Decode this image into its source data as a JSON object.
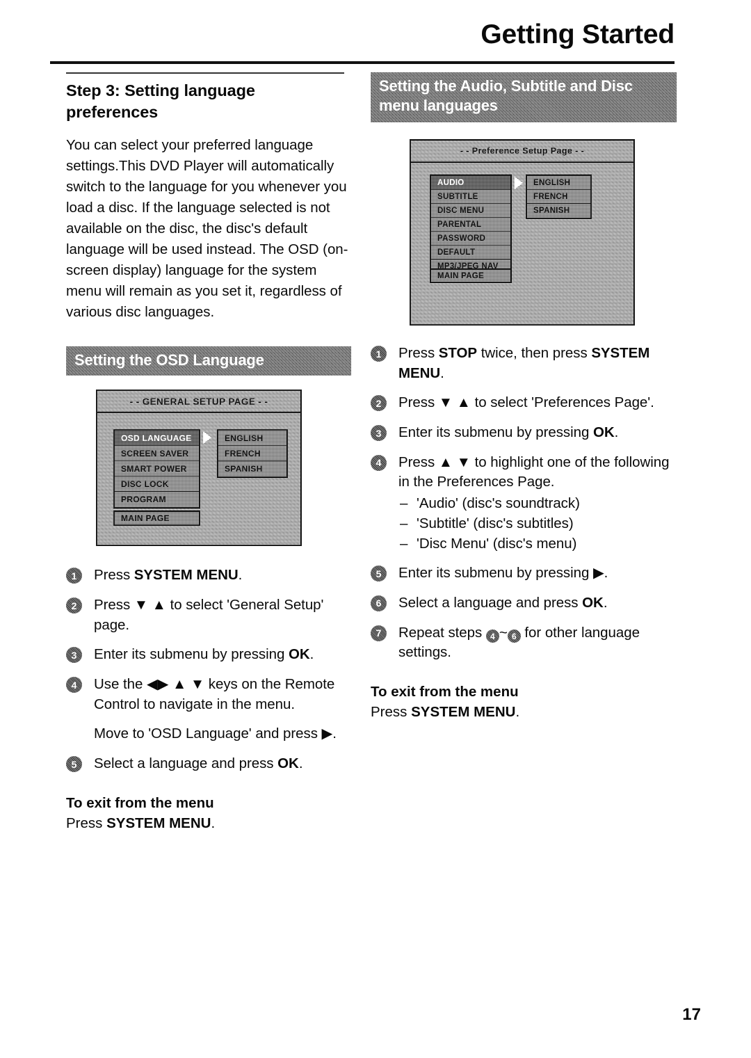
{
  "header": {
    "title": "Getting Started"
  },
  "page_number": "17",
  "left_column": {
    "step_heading": "Step 3:  Setting language preferences",
    "intro_paragraph": "You can select your preferred language settings.This DVD Player will automatically switch to the language for you whenever you load a disc.  If the language selected is not available on the disc, the disc's default language will be used instead. The OSD (on-screen display) language for the system menu will remain as you set it, regardless of various disc languages.",
    "banner": "Setting the OSD Language",
    "menu_screenshot": {
      "title": "- - GENERAL SETUP PAGE - -",
      "items": [
        {
          "label": "OSD LANGUAGE",
          "selected": true
        },
        {
          "label": "SCREEN SAVER",
          "selected": false
        },
        {
          "label": "SMART POWER",
          "selected": false
        },
        {
          "label": "DISC LOCK",
          "selected": false
        },
        {
          "label": "PROGRAM",
          "selected": false
        }
      ],
      "options": [
        "ENGLISH",
        "FRENCH",
        "SPANISH"
      ],
      "main_page_label": "MAIN PAGE"
    },
    "steps": [
      {
        "num": "1",
        "text_parts": [
          {
            "t": "Press "
          },
          {
            "t": "SYSTEM MENU",
            "b": true
          },
          {
            "t": "."
          }
        ]
      },
      {
        "num": "2",
        "text_parts": [
          {
            "t": "Press ▼ ▲ to select 'General Setup' page."
          }
        ]
      },
      {
        "num": "3",
        "text_parts": [
          {
            "t": "Enter its submenu by pressing "
          },
          {
            "t": "OK",
            "b": true
          },
          {
            "t": "."
          }
        ]
      },
      {
        "num": "4",
        "text_parts": [
          {
            "t": "Use the ◀▶ ▲ ▼ keys on the Remote Control to navigate in the menu."
          }
        ],
        "continuation": "Move to 'OSD Language' and press ▶."
      },
      {
        "num": "5",
        "text_parts": [
          {
            "t": "Select a language and press "
          },
          {
            "t": "OK",
            "b": true
          },
          {
            "t": "."
          }
        ]
      }
    ],
    "exit": {
      "title": "To exit from the menu",
      "prefix": "Press ",
      "key": "SYSTEM MENU",
      "suffix": "."
    }
  },
  "right_column": {
    "banner": "Setting the Audio, Subtitle and Disc menu languages",
    "menu_screenshot": {
      "title": "- - Preference Setup Page - -",
      "items": [
        {
          "label": "AUDIO",
          "selected": true
        },
        {
          "label": "SUBTITLE",
          "selected": false
        },
        {
          "label": "DISC MENU",
          "selected": false
        },
        {
          "label": "PARENTAL",
          "selected": false
        },
        {
          "label": "PASSWORD",
          "selected": false
        },
        {
          "label": "DEFAULT",
          "selected": false
        },
        {
          "label": "MP3/JPEG NAV",
          "selected": false
        }
      ],
      "options": [
        "ENGLISH",
        "FRENCH",
        "SPANISH"
      ],
      "main_page_label": "MAIN PAGE"
    },
    "steps": [
      {
        "num": "1",
        "text_parts": [
          {
            "t": "Press "
          },
          {
            "t": "STOP",
            "b": true
          },
          {
            "t": " twice, then press "
          },
          {
            "t": "SYSTEM MENU",
            "b": true
          },
          {
            "t": "."
          }
        ]
      },
      {
        "num": "2",
        "text_parts": [
          {
            "t": "Press ▼ ▲ to select 'Preferences Page'."
          }
        ]
      },
      {
        "num": "3",
        "text_parts": [
          {
            "t": "Enter its submenu by pressing "
          },
          {
            "t": "OK",
            "b": true
          },
          {
            "t": "."
          }
        ]
      },
      {
        "num": "4",
        "text_parts": [
          {
            "t": "Press ▲ ▼ to highlight one of the following in the Preferences Page."
          }
        ],
        "sub_items": [
          "'Audio' (disc's soundtrack)",
          "'Subtitle' (disc's subtitles)",
          "'Disc Menu' (disc's menu)"
        ]
      },
      {
        "num": "5",
        "text_parts": [
          {
            "t": "Enter its submenu by pressing ▶."
          }
        ]
      },
      {
        "num": "6",
        "text_parts": [
          {
            "t": "Select a language and press "
          },
          {
            "t": "OK",
            "b": true
          },
          {
            "t": "."
          }
        ]
      },
      {
        "num": "7",
        "text_parts": [
          {
            "t": "Repeat steps "
          },
          {
            "n": "4"
          },
          {
            "t": "~"
          },
          {
            "n": "6"
          },
          {
            "t": " for other language settings."
          }
        ]
      }
    ],
    "exit": {
      "title": "To exit from the menu",
      "prefix": "Press ",
      "key": "SYSTEM MENU",
      "suffix": "."
    }
  }
}
